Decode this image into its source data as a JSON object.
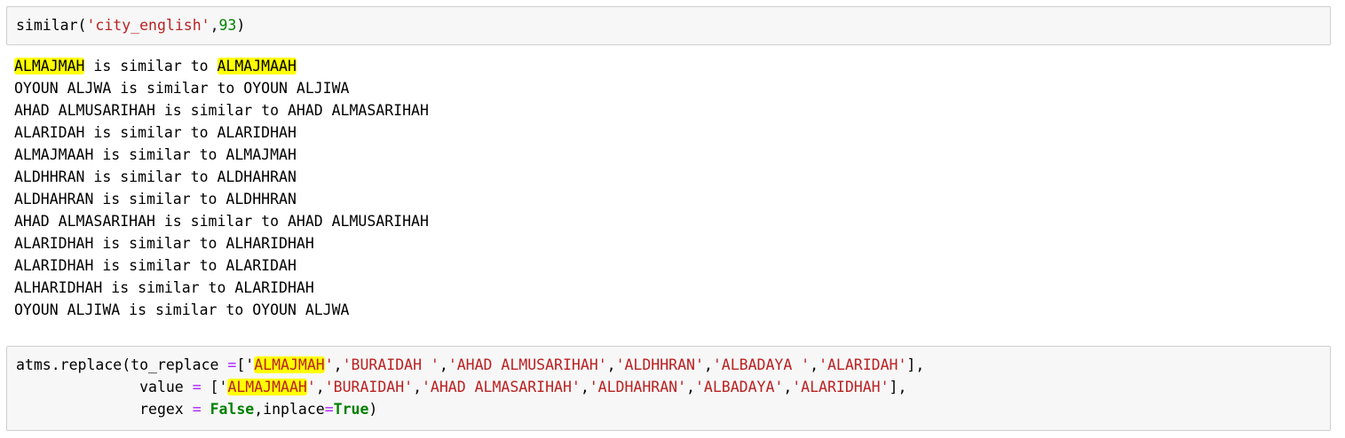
{
  "cells": {
    "similar_call": {
      "func": "similar(",
      "arg_str": "'city_english'",
      "comma": ",",
      "arg_num": "93",
      "close": ")"
    },
    "output": {
      "first_line": {
        "left": "ALMAJMAH",
        "mid": " is similar to ",
        "right": "ALMAJMAAH"
      },
      "lines": [
        "OYOUN ALJWA is similar to OYOUN ALJIWA",
        "AHAD ALMUSARIHAH is similar to AHAD ALMASARIHAH",
        "ALARIDAH is similar to ALARIDHAH",
        "ALMAJMAAH is similar to ALMAJMAH",
        "ALDHHRAN is similar to ALDHAHRAN",
        "ALDHAHRAN is similar to ALDHHRAN",
        "AHAD ALMASARIHAH is similar to AHAD ALMUSARIHAH",
        "ALARIDHAH is similar to ALHARIDHAH",
        "ALARIDHAH is similar to ALARIDAH",
        "ALHARIDHAH is similar to ALARIDHAH",
        "OYOUN ALJIWA is similar to OYOUN ALJWA"
      ]
    },
    "replace_call": {
      "line1": {
        "prefix": "atms.replace(to_replace ",
        "eq": "=",
        "open": "['",
        "hl": "ALMAJMAH",
        "s1_end": "'",
        "c1": ",",
        "s2": "'BURAIDAH '",
        "c2": ",",
        "s3": "'AHAD ALMUSARIHAH'",
        "c3": ",",
        "s4": "'ALDHHRAN'",
        "c4": ",",
        "s5": "'ALBADAYA '",
        "c5": ",",
        "s6": "'ALARIDAH'",
        "close": "],"
      },
      "line2": {
        "indent": "              value ",
        "eq": "=",
        "open": " ['",
        "hl": "ALMAJMAAH",
        "s1_end": "'",
        "c1": ",",
        "s2": "'BURAIDAH'",
        "c2": ",",
        "s3": "'AHAD ALMASARIHAH'",
        "c3": ",",
        "s4": "'ALDHAHRAN'",
        "c4": ",",
        "s5": "'ALBADAYA'",
        "c5": ",",
        "s6": "'ALARIDHAH'",
        "close": "],"
      },
      "line3": {
        "indent": "              regex ",
        "eq1": "=",
        "sp": " ",
        "false_kw": "False",
        "mid": ",inplace",
        "eq2": "=",
        "true_kw": "True",
        "close": ")"
      }
    }
  },
  "colors": {
    "string": "#ba2121",
    "number": "#008000",
    "keyword": "#008000",
    "operator": "#aa22ff",
    "highlight": "#ffff00",
    "cell_background": "#f7f7f7",
    "cell_border": "#cfcfcf"
  }
}
